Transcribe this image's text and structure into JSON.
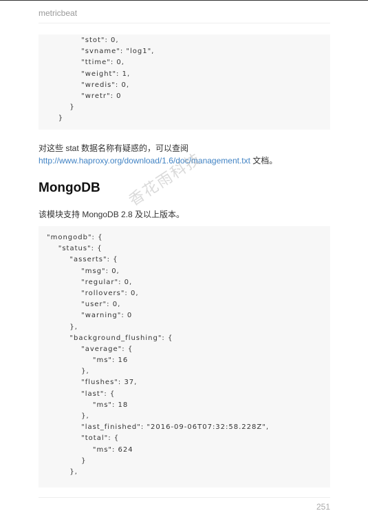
{
  "header": {
    "title": "metricbeat"
  },
  "code_top": {
    "lines": [
      "            \"stot\": 0,",
      "            \"svname\": \"log1\",",
      "            \"ttime\": 0,",
      "            \"weight\": 1,",
      "            \"wredis\": 0,",
      "            \"wretr\": 0",
      "        }",
      "    }"
    ]
  },
  "paragraph1": {
    "text": "对这些 stat 数据名称有疑惑的，可以查阅",
    "link": "http://www.haproxy.org/download/1.6/doc/management.txt",
    "suffix": " 文档。"
  },
  "section": {
    "title": "MongoDB"
  },
  "paragraph2": {
    "text": "该模块支持 MongoDB 2.8 及以上版本。"
  },
  "watermark": {
    "text": "香花雨科技"
  },
  "code_bottom": {
    "lines": [
      "\"mongodb\": {",
      "    \"status\": {",
      "        \"asserts\": {",
      "            \"msg\": 0,",
      "            \"regular\": 0,",
      "            \"rollovers\": 0,",
      "            \"user\": 0,",
      "            \"warning\": 0",
      "        },",
      "        \"background_flushing\": {",
      "            \"average\": {",
      "                \"ms\": 16",
      "            },",
      "            \"flushes\": 37,",
      "            \"last\": {",
      "                \"ms\": 18",
      "            },",
      "            \"last_finished\": \"2016-09-06T07:32:58.228Z\",",
      "            \"total\": {",
      "                \"ms\": 624",
      "            }",
      "        },"
    ]
  },
  "footer": {
    "page_number": "251"
  }
}
